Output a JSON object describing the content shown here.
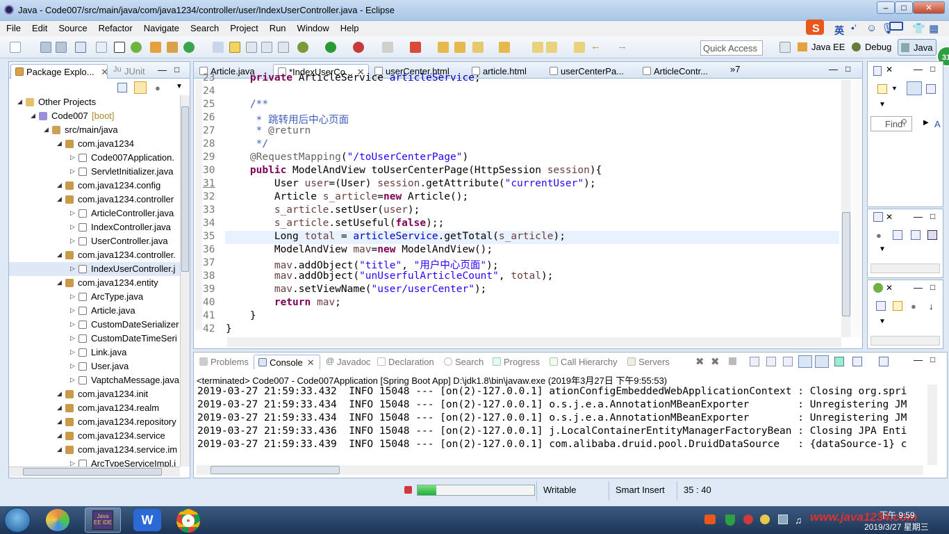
{
  "window": {
    "title": "Java - Code007/src/main/java/com/java1234/controller/user/IndexUserController.java - Eclipse"
  },
  "menu": [
    "File",
    "Edit",
    "Source",
    "Refactor",
    "Navigate",
    "Search",
    "Project",
    "Run",
    "Window",
    "Help"
  ],
  "toolbar": {
    "quick_access": "Quick Access",
    "perspectives": [
      "Java EE",
      "Debug",
      "Java"
    ]
  },
  "left_panel": {
    "tabs": [
      "Package Explo...",
      "JUnit"
    ],
    "tree": [
      {
        "label": "Other Projects",
        "indent": 0,
        "kind": "folder"
      },
      {
        "label": "Code007",
        "suffix": " [boot]",
        "indent": 1,
        "kind": "project"
      },
      {
        "label": "src/main/java",
        "indent": 2,
        "kind": "src"
      },
      {
        "label": "com.java1234",
        "indent": 3,
        "kind": "pkg"
      },
      {
        "label": "Code007Application.",
        "indent": 4,
        "kind": "java"
      },
      {
        "label": "ServletInitializer.java",
        "indent": 4,
        "kind": "java"
      },
      {
        "label": "com.java1234.config",
        "indent": 3,
        "kind": "pkg"
      },
      {
        "label": "com.java1234.controller",
        "indent": 3,
        "kind": "pkg"
      },
      {
        "label": "ArticleController.java",
        "indent": 4,
        "kind": "java"
      },
      {
        "label": "IndexController.java",
        "indent": 4,
        "kind": "java"
      },
      {
        "label": "UserController.java",
        "indent": 4,
        "kind": "java"
      },
      {
        "label": "com.java1234.controller.",
        "indent": 3,
        "kind": "pkg"
      },
      {
        "label": "IndexUserController.j",
        "indent": 4,
        "kind": "java",
        "selected": true
      },
      {
        "label": "com.java1234.entity",
        "indent": 3,
        "kind": "pkg"
      },
      {
        "label": "ArcType.java",
        "indent": 4,
        "kind": "java"
      },
      {
        "label": "Article.java",
        "indent": 4,
        "kind": "java"
      },
      {
        "label": "CustomDateSerializer",
        "indent": 4,
        "kind": "java"
      },
      {
        "label": "CustomDateTimeSeri",
        "indent": 4,
        "kind": "java"
      },
      {
        "label": "Link.java",
        "indent": 4,
        "kind": "java"
      },
      {
        "label": "User.java",
        "indent": 4,
        "kind": "java"
      },
      {
        "label": "VaptchaMessage.java",
        "indent": 4,
        "kind": "java"
      },
      {
        "label": "com.java1234.init",
        "indent": 3,
        "kind": "pkg"
      },
      {
        "label": "com.java1234.realm",
        "indent": 3,
        "kind": "pkg"
      },
      {
        "label": "com.java1234.repository",
        "indent": 3,
        "kind": "pkg"
      },
      {
        "label": "com.java1234.service",
        "indent": 3,
        "kind": "pkg"
      },
      {
        "label": "com.java1234.service.im",
        "indent": 3,
        "kind": "pkg"
      },
      {
        "label": "ArcTypeServiceImpl.j",
        "indent": 4,
        "kind": "java"
      }
    ]
  },
  "editor": {
    "tabs": [
      "Article.java",
      "*IndexUserCo...",
      "userCenter.html",
      "article.html",
      "userCenterPa...",
      "ArticleContr..."
    ],
    "overflow": "»7",
    "lines": [
      {
        "n": "23",
        "html": "    <span class=\"kw\">private</span> ArticleService <span class=\"fld\">articleService</span>;"
      },
      {
        "n": "24",
        "html": ""
      },
      {
        "n": "25",
        "html": "    <span class=\"jd\">/**</span>"
      },
      {
        "n": "26",
        "html": "     <span class=\"jd\">* 跳转用后中心页面</span>"
      },
      {
        "n": "27",
        "html": "     <span class=\"jd\">* </span><span class=\"ann\">@return</span>"
      },
      {
        "n": "28",
        "html": "     <span class=\"jd\">*/</span>"
      },
      {
        "n": "29",
        "html": "    <span class=\"ann\">@RequestMapping</span>(<span class=\"str\">\"/toUserCenterPage\"</span>)"
      },
      {
        "n": "30",
        "html": "    <span class=\"kw\">public</span> ModelAndView toUserCenterPage(HttpSession <span class=\"vr\">session</span>){"
      },
      {
        "n": "31",
        "html": "        User <span class=\"vr\">user</span>=(User) <span class=\"vr\">session</span>.getAttribute(<span class=\"str\">\"currentUser\"</span>);"
      },
      {
        "n": "32",
        "html": "        Article <span class=\"vr\">s_article</span>=<span class=\"kw\">new</span> Article();"
      },
      {
        "n": "33",
        "html": "        <span class=\"vr\">s_article</span>.setUser(<span class=\"vr\">user</span>);"
      },
      {
        "n": "34",
        "html": "        <span class=\"vr\">s_article</span>.setUseful(<span class=\"kw\">false</span>);;"
      },
      {
        "n": "35",
        "html": "        Long <span class=\"vr\">total</span> = <span class=\"fld\">articleService</span>.getTotal(<span class=\"vr\">s_article</span>);"
      },
      {
        "n": "36",
        "html": "        ModelAndView <span class=\"vr\">mav</span>=<span class=\"kw\">new</span> ModelAndView();"
      },
      {
        "n": "37",
        "html": "        <span class=\"vr\">mav</span>.addObject(<span class=\"str\">\"title\"</span>, <span class=\"str\">\"用户中心页面\"</span>);"
      },
      {
        "n": "38",
        "html": "        <span class=\"vr\">mav</span>.addObject(<span class=\"str\">\"unUserfulArticleCount\"</span>, <span class=\"vr\">total</span>);"
      },
      {
        "n": "39",
        "html": "        <span class=\"vr\">mav</span>.setViewName(<span class=\"str\">\"user/userCenter\"</span>);"
      },
      {
        "n": "40",
        "html": "        <span class=\"kw\">return</span> <span class=\"vr\">mav</span>;"
      },
      {
        "n": "41",
        "html": "    }"
      },
      {
        "n": "42",
        "html": "}"
      }
    ]
  },
  "console": {
    "tabs": [
      "Problems",
      "Console",
      "Javadoc",
      "Declaration",
      "Search",
      "Progress",
      "Call Hierarchy",
      "Servers"
    ],
    "header": "<terminated> Code007 - Code007Application [Spring Boot App] D:\\jdk1.8\\bin\\javaw.exe (2019年3月27日 下午9:55:53)",
    "lines": [
      "2019-03-27 21:59:33.432  INFO 15048 --- [on(2)-127.0.0.1] ationConfigEmbeddedWebApplicationContext : Closing org.spri",
      "2019-03-27 21:59:33.434  INFO 15048 --- [on(2)-127.0.0.1] o.s.j.e.a.AnnotationMBeanExporter        : Unregistering JM",
      "2019-03-27 21:59:33.434  INFO 15048 --- [on(2)-127.0.0.1] o.s.j.e.a.AnnotationMBeanExporter        : Unregistering JM",
      "2019-03-27 21:59:33.436  INFO 15048 --- [on(2)-127.0.0.1] j.LocalContainerEntityManagerFactoryBean : Closing JPA Enti",
      "2019-03-27 21:59:33.439  INFO 15048 --- [on(2)-127.0.0.1] com.alibaba.druid.pool.DruidDataSource   : {dataSource-1} c"
    ]
  },
  "right_panel": {
    "find_placeholder": "Find",
    "a_label": "A"
  },
  "status": {
    "writable": "Writable",
    "insert": "Smart Insert",
    "position": "35 : 40"
  },
  "ime": {
    "lang": "英"
  },
  "taskbar": {
    "time": "下午 9:59",
    "date": "2019/3/27 星期三",
    "watermark": "www.java1234.com",
    "badge": "31",
    "eclipse_label": "Java EE IDE"
  }
}
